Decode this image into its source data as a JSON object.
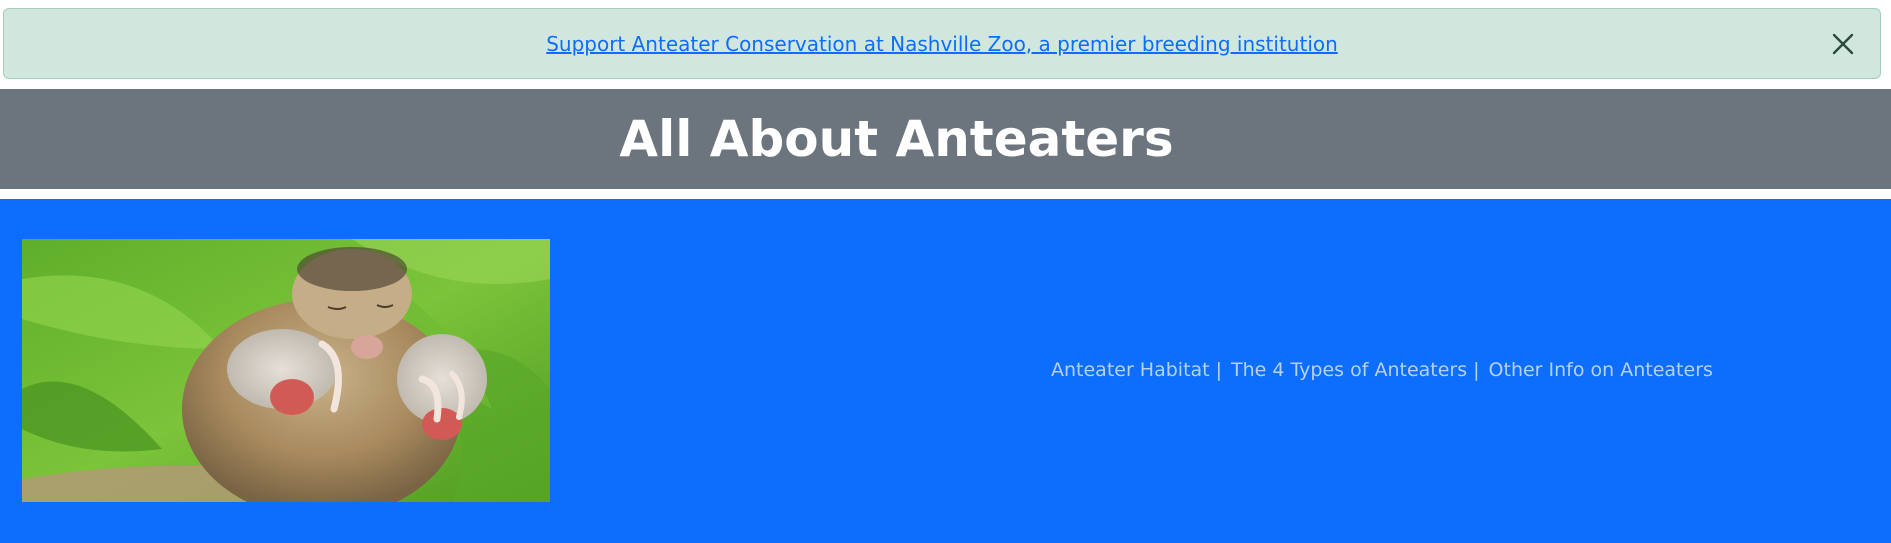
{
  "alert": {
    "link_text": "Support Anteater Conservation at Nashville Zoo, a premier breeding institution",
    "close_icon": "close-icon"
  },
  "header": {
    "title": "All About Anteaters"
  },
  "main": {
    "image_subject": "anteater-photo",
    "nav": {
      "items": [
        {
          "label": "Anteater Habitat"
        },
        {
          "label": "The 4 Types of Anteaters"
        },
        {
          "label": "Other Info on Anteaters"
        }
      ],
      "separator": "|"
    }
  },
  "colors": {
    "alert_bg": "#d1e7dd",
    "link": "#0d6efd",
    "header_bg": "#6c757d",
    "main_bg": "#0d6efd",
    "nav_text": "#b6d0f7"
  }
}
